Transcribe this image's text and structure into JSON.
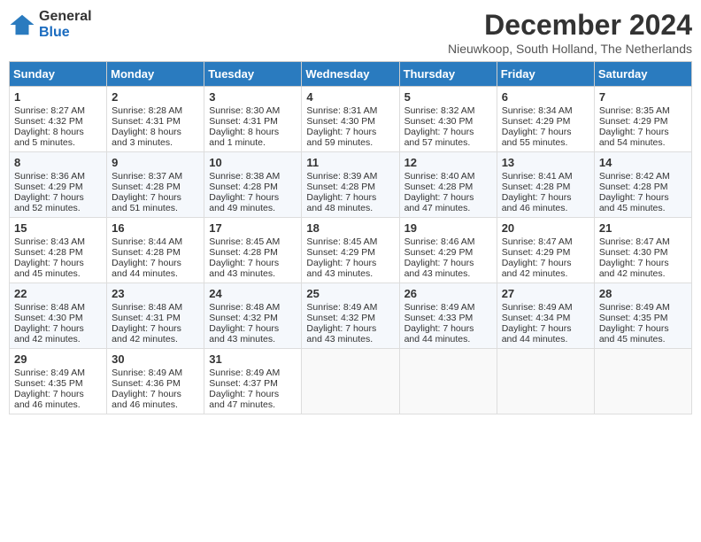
{
  "header": {
    "logo_general": "General",
    "logo_blue": "Blue",
    "month_title": "December 2024",
    "subtitle": "Nieuwkoop, South Holland, The Netherlands"
  },
  "days_of_week": [
    "Sunday",
    "Monday",
    "Tuesday",
    "Wednesday",
    "Thursday",
    "Friday",
    "Saturday"
  ],
  "weeks": [
    [
      {
        "day": "1",
        "sunrise": "Sunrise: 8:27 AM",
        "sunset": "Sunset: 4:32 PM",
        "daylight": "Daylight: 8 hours and 5 minutes."
      },
      {
        "day": "2",
        "sunrise": "Sunrise: 8:28 AM",
        "sunset": "Sunset: 4:31 PM",
        "daylight": "Daylight: 8 hours and 3 minutes."
      },
      {
        "day": "3",
        "sunrise": "Sunrise: 8:30 AM",
        "sunset": "Sunset: 4:31 PM",
        "daylight": "Daylight: 8 hours and 1 minute."
      },
      {
        "day": "4",
        "sunrise": "Sunrise: 8:31 AM",
        "sunset": "Sunset: 4:30 PM",
        "daylight": "Daylight: 7 hours and 59 minutes."
      },
      {
        "day": "5",
        "sunrise": "Sunrise: 8:32 AM",
        "sunset": "Sunset: 4:30 PM",
        "daylight": "Daylight: 7 hours and 57 minutes."
      },
      {
        "day": "6",
        "sunrise": "Sunrise: 8:34 AM",
        "sunset": "Sunset: 4:29 PM",
        "daylight": "Daylight: 7 hours and 55 minutes."
      },
      {
        "day": "7",
        "sunrise": "Sunrise: 8:35 AM",
        "sunset": "Sunset: 4:29 PM",
        "daylight": "Daylight: 7 hours and 54 minutes."
      }
    ],
    [
      {
        "day": "8",
        "sunrise": "Sunrise: 8:36 AM",
        "sunset": "Sunset: 4:29 PM",
        "daylight": "Daylight: 7 hours and 52 minutes."
      },
      {
        "day": "9",
        "sunrise": "Sunrise: 8:37 AM",
        "sunset": "Sunset: 4:28 PM",
        "daylight": "Daylight: 7 hours and 51 minutes."
      },
      {
        "day": "10",
        "sunrise": "Sunrise: 8:38 AM",
        "sunset": "Sunset: 4:28 PM",
        "daylight": "Daylight: 7 hours and 49 minutes."
      },
      {
        "day": "11",
        "sunrise": "Sunrise: 8:39 AM",
        "sunset": "Sunset: 4:28 PM",
        "daylight": "Daylight: 7 hours and 48 minutes."
      },
      {
        "day": "12",
        "sunrise": "Sunrise: 8:40 AM",
        "sunset": "Sunset: 4:28 PM",
        "daylight": "Daylight: 7 hours and 47 minutes."
      },
      {
        "day": "13",
        "sunrise": "Sunrise: 8:41 AM",
        "sunset": "Sunset: 4:28 PM",
        "daylight": "Daylight: 7 hours and 46 minutes."
      },
      {
        "day": "14",
        "sunrise": "Sunrise: 8:42 AM",
        "sunset": "Sunset: 4:28 PM",
        "daylight": "Daylight: 7 hours and 45 minutes."
      }
    ],
    [
      {
        "day": "15",
        "sunrise": "Sunrise: 8:43 AM",
        "sunset": "Sunset: 4:28 PM",
        "daylight": "Daylight: 7 hours and 45 minutes."
      },
      {
        "day": "16",
        "sunrise": "Sunrise: 8:44 AM",
        "sunset": "Sunset: 4:28 PM",
        "daylight": "Daylight: 7 hours and 44 minutes."
      },
      {
        "day": "17",
        "sunrise": "Sunrise: 8:45 AM",
        "sunset": "Sunset: 4:28 PM",
        "daylight": "Daylight: 7 hours and 43 minutes."
      },
      {
        "day": "18",
        "sunrise": "Sunrise: 8:45 AM",
        "sunset": "Sunset: 4:29 PM",
        "daylight": "Daylight: 7 hours and 43 minutes."
      },
      {
        "day": "19",
        "sunrise": "Sunrise: 8:46 AM",
        "sunset": "Sunset: 4:29 PM",
        "daylight": "Daylight: 7 hours and 43 minutes."
      },
      {
        "day": "20",
        "sunrise": "Sunrise: 8:47 AM",
        "sunset": "Sunset: 4:29 PM",
        "daylight": "Daylight: 7 hours and 42 minutes."
      },
      {
        "day": "21",
        "sunrise": "Sunrise: 8:47 AM",
        "sunset": "Sunset: 4:30 PM",
        "daylight": "Daylight: 7 hours and 42 minutes."
      }
    ],
    [
      {
        "day": "22",
        "sunrise": "Sunrise: 8:48 AM",
        "sunset": "Sunset: 4:30 PM",
        "daylight": "Daylight: 7 hours and 42 minutes."
      },
      {
        "day": "23",
        "sunrise": "Sunrise: 8:48 AM",
        "sunset": "Sunset: 4:31 PM",
        "daylight": "Daylight: 7 hours and 42 minutes."
      },
      {
        "day": "24",
        "sunrise": "Sunrise: 8:48 AM",
        "sunset": "Sunset: 4:32 PM",
        "daylight": "Daylight: 7 hours and 43 minutes."
      },
      {
        "day": "25",
        "sunrise": "Sunrise: 8:49 AM",
        "sunset": "Sunset: 4:32 PM",
        "daylight": "Daylight: 7 hours and 43 minutes."
      },
      {
        "day": "26",
        "sunrise": "Sunrise: 8:49 AM",
        "sunset": "Sunset: 4:33 PM",
        "daylight": "Daylight: 7 hours and 44 minutes."
      },
      {
        "day": "27",
        "sunrise": "Sunrise: 8:49 AM",
        "sunset": "Sunset: 4:34 PM",
        "daylight": "Daylight: 7 hours and 44 minutes."
      },
      {
        "day": "28",
        "sunrise": "Sunrise: 8:49 AM",
        "sunset": "Sunset: 4:35 PM",
        "daylight": "Daylight: 7 hours and 45 minutes."
      }
    ],
    [
      {
        "day": "29",
        "sunrise": "Sunrise: 8:49 AM",
        "sunset": "Sunset: 4:35 PM",
        "daylight": "Daylight: 7 hours and 46 minutes."
      },
      {
        "day": "30",
        "sunrise": "Sunrise: 8:49 AM",
        "sunset": "Sunset: 4:36 PM",
        "daylight": "Daylight: 7 hours and 46 minutes."
      },
      {
        "day": "31",
        "sunrise": "Sunrise: 8:49 AM",
        "sunset": "Sunset: 4:37 PM",
        "daylight": "Daylight: 7 hours and 47 minutes."
      },
      null,
      null,
      null,
      null
    ]
  ]
}
